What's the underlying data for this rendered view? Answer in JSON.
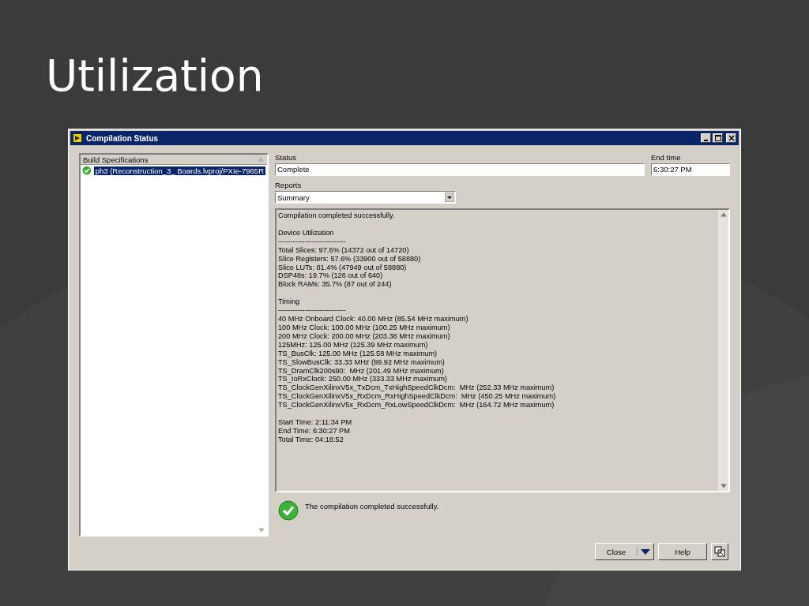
{
  "slide": {
    "title": "Utilization"
  },
  "window": {
    "title": "Compilation Status"
  },
  "build_specifications": {
    "header": "Build Specifications",
    "items": [
      {
        "label": "ph3 (Reconstruction_3_ Boards.lvproj/PXIe-7965R",
        "succeeded": true,
        "selected": true
      }
    ]
  },
  "status": {
    "label": "Status",
    "value": "Complete"
  },
  "end_time": {
    "label": "End time",
    "value": "6:30:27 PM"
  },
  "reports": {
    "label": "Reports",
    "value": "Summary"
  },
  "report_sections": [
    [
      "Compilation completed successfully."
    ],
    [
      "Device Utilization",
      "----------------------------",
      "Total Slices: 97.6% (14372 out of 14720)",
      "Slice Registers: 57.6% (33900 out of 58880)",
      "Slice LUTs: 81.4% (47949 out of 58880)",
      "DSP48s: 19.7% (126 out of 640)",
      "Block RAMs: 35.7% (87 out of 244)"
    ],
    [
      "Timing",
      "----------------------------",
      "40 MHz Onboard Clock: 40.00 MHz (85.54 MHz maximum)",
      "100 MHz Clock: 100.00 MHz (100.25 MHz maximum)",
      "200 MHz Clock: 200.00 MHz (203.38 MHz maximum)",
      "125MHz: 125.00 MHz (125.39 MHz maximum)",
      "TS_BusClk: 125.00 MHz (125.58 MHz maximum)",
      "TS_SlowBusClk: 33.33 MHz (99.92 MHz maximum)",
      "TS_DramClk200s90:  MHz (201.49 MHz maximum)",
      "TS_IoRxClock: 250.00 MHz (333.33 MHz maximum)",
      "TS_ClockGenXilinxV5x_TxDcm_TxHighSpeedClkDcm:  MHz (252.33 MHz maximum)",
      "TS_ClockGenXilinxV5x_RxDcm_RxHighSpeedClkDcm:  MHz (450.25 MHz maximum)",
      "TS_ClockGenXilinxV5x_RxDcm_RxLowSpeedClkDcm:  MHz (164.72 MHz maximum)"
    ],
    [
      "Start Time: 2:11:34 PM",
      "End Time: 6:30:27 PM",
      "Total Time: 04:18:52"
    ]
  ],
  "message": {
    "succeeded": true,
    "text": "The compilation completed successfully."
  },
  "buttons": [
    {
      "label": "Close",
      "kind": "split"
    },
    {
      "label": "Help",
      "kind": "plain"
    },
    {
      "kind": "icon"
    }
  ]
}
